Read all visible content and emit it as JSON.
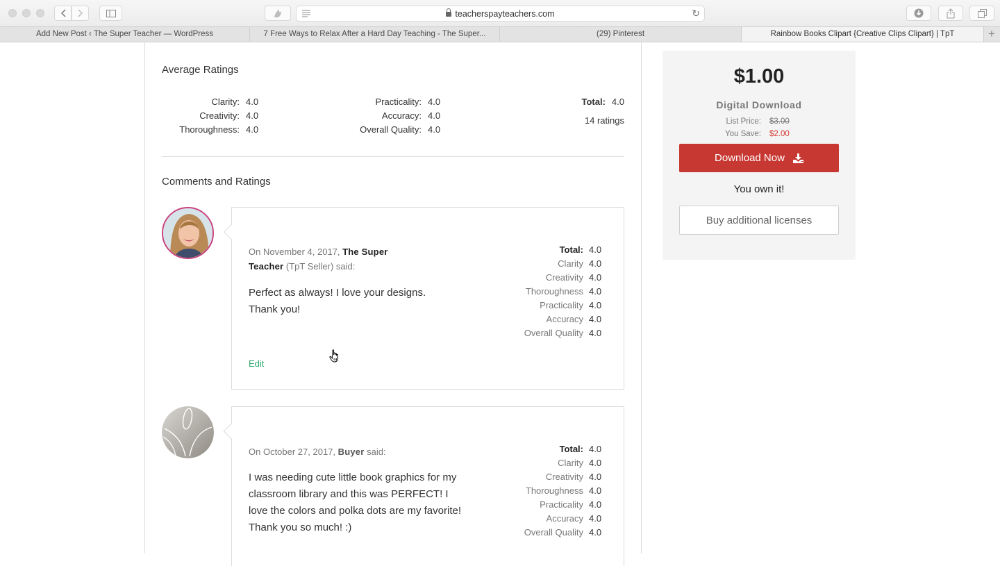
{
  "browser": {
    "url": "teacherspayteachers.com",
    "tabs": [
      {
        "label": "Add New Post ‹ The Super Teacher — WordPress",
        "active": false
      },
      {
        "label": "7 Free Ways to Relax After a Hard Day Teaching - The Super...",
        "active": false
      },
      {
        "label": "(29) Pinterest",
        "active": false
      },
      {
        "label": "Rainbow Books Clipart {Creative Clips Clipart} | TpT",
        "active": true
      }
    ]
  },
  "average_ratings": {
    "title": "Average Ratings",
    "col1": [
      {
        "label": "Clarity:",
        "value": "4.0"
      },
      {
        "label": "Creativity:",
        "value": "4.0"
      },
      {
        "label": "Thoroughness:",
        "value": "4.0"
      }
    ],
    "col2": [
      {
        "label": "Practicality:",
        "value": "4.0"
      },
      {
        "label": "Accuracy:",
        "value": "4.0"
      },
      {
        "label": "Overall Quality:",
        "value": "4.0"
      }
    ],
    "total_label": "Total:",
    "total_value": "4.0",
    "count": "14 ratings"
  },
  "comments": {
    "title": "Comments and Ratings",
    "reviews": [
      {
        "prefix": "On November 4, 2017, ",
        "author": "The Super Teacher",
        "role": " (TpT Seller)",
        "suffix": " said:",
        "text": "Perfect as always!  I love your designs. Thank you!",
        "edit_label": "Edit",
        "ratings": [
          {
            "label": "Total:",
            "value": "4.0"
          },
          {
            "label": "Clarity",
            "value": "4.0"
          },
          {
            "label": "Creativity",
            "value": "4.0"
          },
          {
            "label": "Thoroughness",
            "value": "4.0"
          },
          {
            "label": "Practicality",
            "value": "4.0"
          },
          {
            "label": "Accuracy",
            "value": "4.0"
          },
          {
            "label": "Overall Quality",
            "value": "4.0"
          }
        ]
      },
      {
        "prefix": "On October 27, 2017, ",
        "author": "Buyer",
        "suffix": " said:",
        "text": "I was needing cute little book graphics for my classroom library and this was PERFECT! I love the colors and polka dots are my favorite! Thank you so much! :)",
        "ratings": [
          {
            "label": "Total:",
            "value": "4.0"
          },
          {
            "label": "Clarity",
            "value": "4.0"
          },
          {
            "label": "Creativity",
            "value": "4.0"
          },
          {
            "label": "Thoroughness",
            "value": "4.0"
          },
          {
            "label": "Practicality",
            "value": "4.0"
          },
          {
            "label": "Accuracy",
            "value": "4.0"
          },
          {
            "label": "Overall Quality",
            "value": "4.0"
          }
        ]
      }
    ]
  },
  "purchase": {
    "price": "$1.00",
    "format": "Digital Download",
    "list_price_label": "List Price:",
    "list_price": "$3.00",
    "save_label": "You Save:",
    "save_value": "$2.00",
    "download_label": "Download Now",
    "owned_text": "You own it!",
    "licenses_label": "Buy additional licenses",
    "accent_color": "#c83832"
  }
}
